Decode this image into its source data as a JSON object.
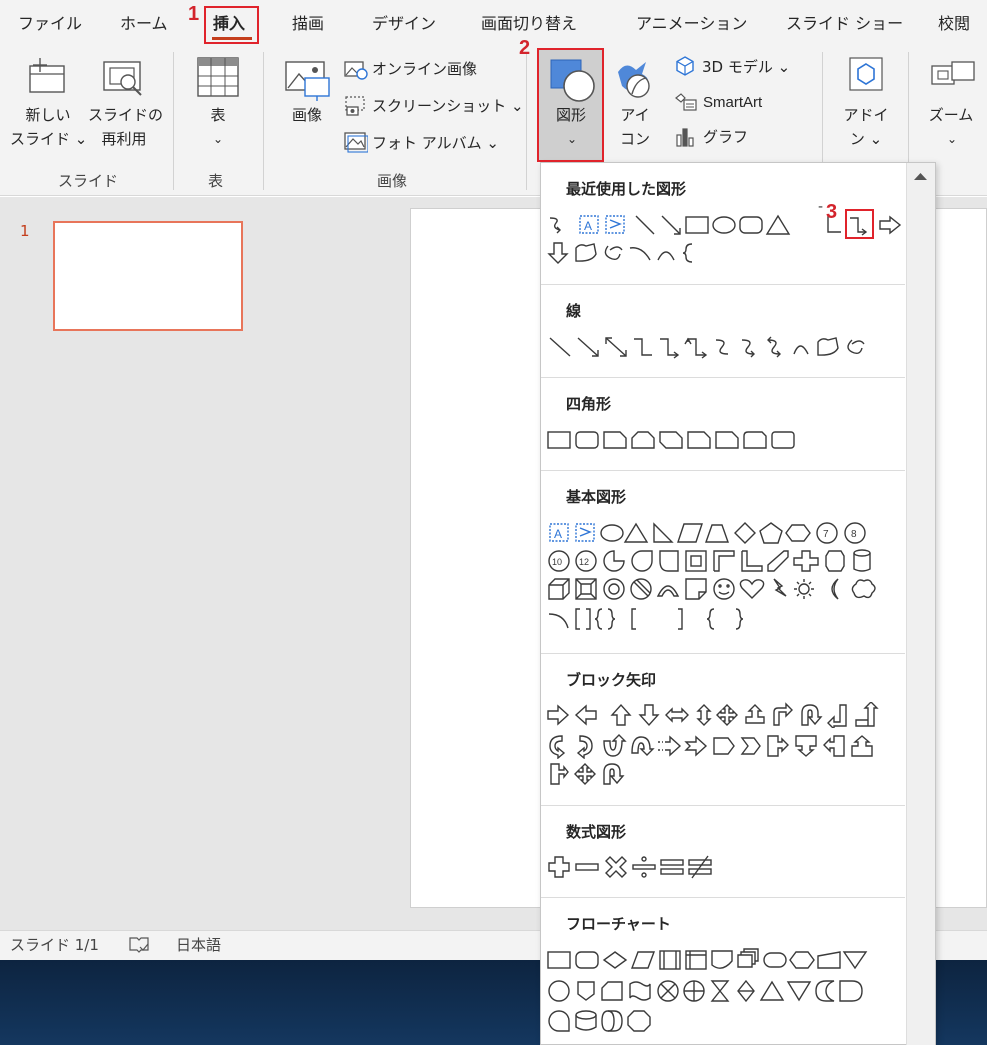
{
  "tabs": [
    {
      "label": "ファイル"
    },
    {
      "label": "ホーム"
    },
    {
      "label": "挿入"
    },
    {
      "label": "描画"
    },
    {
      "label": "デザイン"
    },
    {
      "label": "画面切り替え"
    },
    {
      "label": "アニメーション"
    },
    {
      "label": "スライド ショー"
    },
    {
      "label": "校閲"
    }
  ],
  "ribbon": {
    "new_slide": "新しい\nスライド ⌄",
    "new_slide_l1": "新しい",
    "new_slide_l2": "スライド ⌄",
    "reuse_l1": "スライドの",
    "reuse_l2": "再利用",
    "table_label": "表",
    "image_label": "画像",
    "online_image": "オンライン画像",
    "screenshot": "スクリーンショット ⌄",
    "photo_album": "フォト アルバム ⌄",
    "shapes_label": "図形",
    "icons_l1": "アイ",
    "icons_l2": "コン",
    "model3d": "3D モデル ⌄",
    "smartart": "SmartArt",
    "graph": "グラフ",
    "addin_l1": "アドイ",
    "addin_l2": "ン ⌄",
    "zoom_label": "ズーム",
    "groups": {
      "slides": "スライド",
      "table": "表",
      "images": "画像"
    }
  },
  "annotations": [
    "1",
    "2",
    "3"
  ],
  "gallery": {
    "sections": [
      {
        "title": "最近使用した図形"
      },
      {
        "title": "線"
      },
      {
        "title": "四角形"
      },
      {
        "title": "基本図形"
      },
      {
        "title": "ブロック矢印"
      },
      {
        "title": "数式図形"
      },
      {
        "title": "フローチャート"
      }
    ],
    "stray_mark": "-"
  },
  "thumbnail": {
    "number": "1"
  },
  "status": {
    "slide_count": "スライド 1/1",
    "language": "日本語"
  },
  "colors": {
    "accent": "#c43e1c",
    "annotation_red": "#e0232b",
    "selection_blue": "#2e75d6"
  }
}
